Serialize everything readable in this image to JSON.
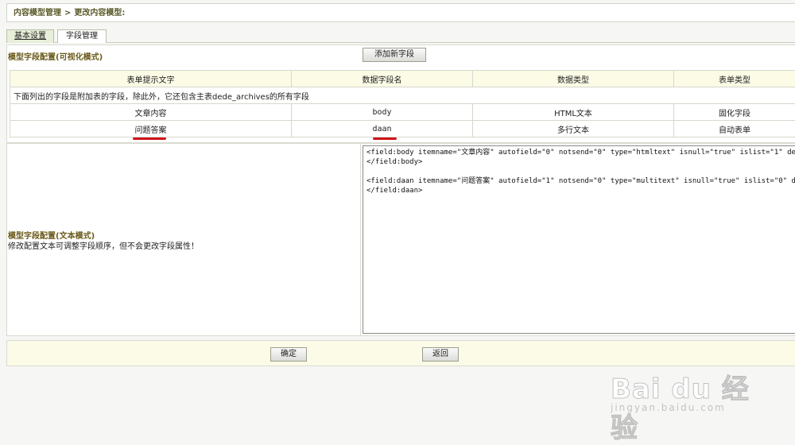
{
  "breadcrumb": {
    "item1": "内容模型管理",
    "separator": ">",
    "item2": "更改内容模型:"
  },
  "tabs": [
    {
      "label": "基本设置",
      "active": true
    },
    {
      "label": "字段管理",
      "active": false
    }
  ],
  "visual_section": {
    "title": "模型字段配置(可视化模式)",
    "add_button": "添加新字段"
  },
  "table": {
    "headers": [
      "表单提示文字",
      "数据字段名",
      "数据类型",
      "表单类型"
    ],
    "note": "下面列出的字段是附加表的字段，除此外，它还包含主表dede_archives的所有字段",
    "rows": [
      [
        "文章内容",
        "body",
        "HTML文本",
        "固化字段"
      ],
      [
        "问题答案",
        "daan",
        "多行文本",
        "自动表单"
      ]
    ]
  },
  "text_section": {
    "title": "模型字段配置(文本模式)",
    "description": "修改配置文本可调整字段顺序，但不会更改字段属性！",
    "config_text": "<field:body itemname=\"文章内容\" autofield=\"0\" notsend=\"0\" type=\"htmltext\" isnull=\"true\" islist=\"1\" default=\"\"  maxlength\n</field:body>\n\n<field:daan itemname=\"问题答案\" autofield=\"1\" notsend=\"0\" type=\"multitext\" isnull=\"true\" islist=\"0\" default=\"\"  maxle\n</field:daan>"
  },
  "footer": {
    "ok_button": "确定",
    "back_button": "返回"
  },
  "watermark": {
    "main": "Bai du 经验",
    "sub": "jingyan.baidu.com"
  },
  "colors": {
    "annotation": "#d0141a",
    "section_title": "#6a5a1a",
    "header_bg": "#fbfbe6"
  }
}
